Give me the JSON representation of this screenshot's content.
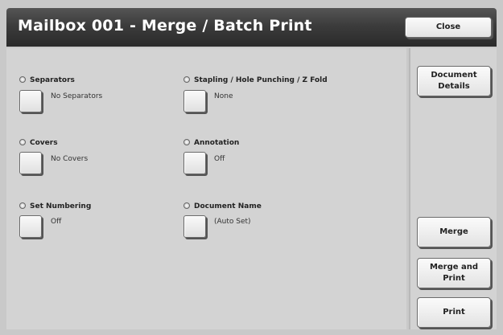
{
  "header": {
    "title": "Mailbox 001 - Merge / Batch Print",
    "close_label": "Close"
  },
  "sidebar": {
    "document_details_label": "Document\nDetails",
    "merge_label": "Merge",
    "merge_and_print_label": "Merge and Print",
    "print_label": "Print"
  },
  "fields": {
    "separators": {
      "label": "Separators",
      "value": "No Separators"
    },
    "covers": {
      "label": "Covers",
      "value": "No Covers"
    },
    "set_numbering": {
      "label": "Set Numbering",
      "value": "Off"
    },
    "stapling": {
      "label": "Stapling / Hole Punching / Z Fold",
      "value": "None"
    },
    "annotation": {
      "label": "Annotation",
      "value": "Off"
    },
    "document_name": {
      "label": "Document Name",
      "value": "(Auto Set)"
    }
  },
  "icons": {
    "field_marker": "radio-dot-icon"
  }
}
